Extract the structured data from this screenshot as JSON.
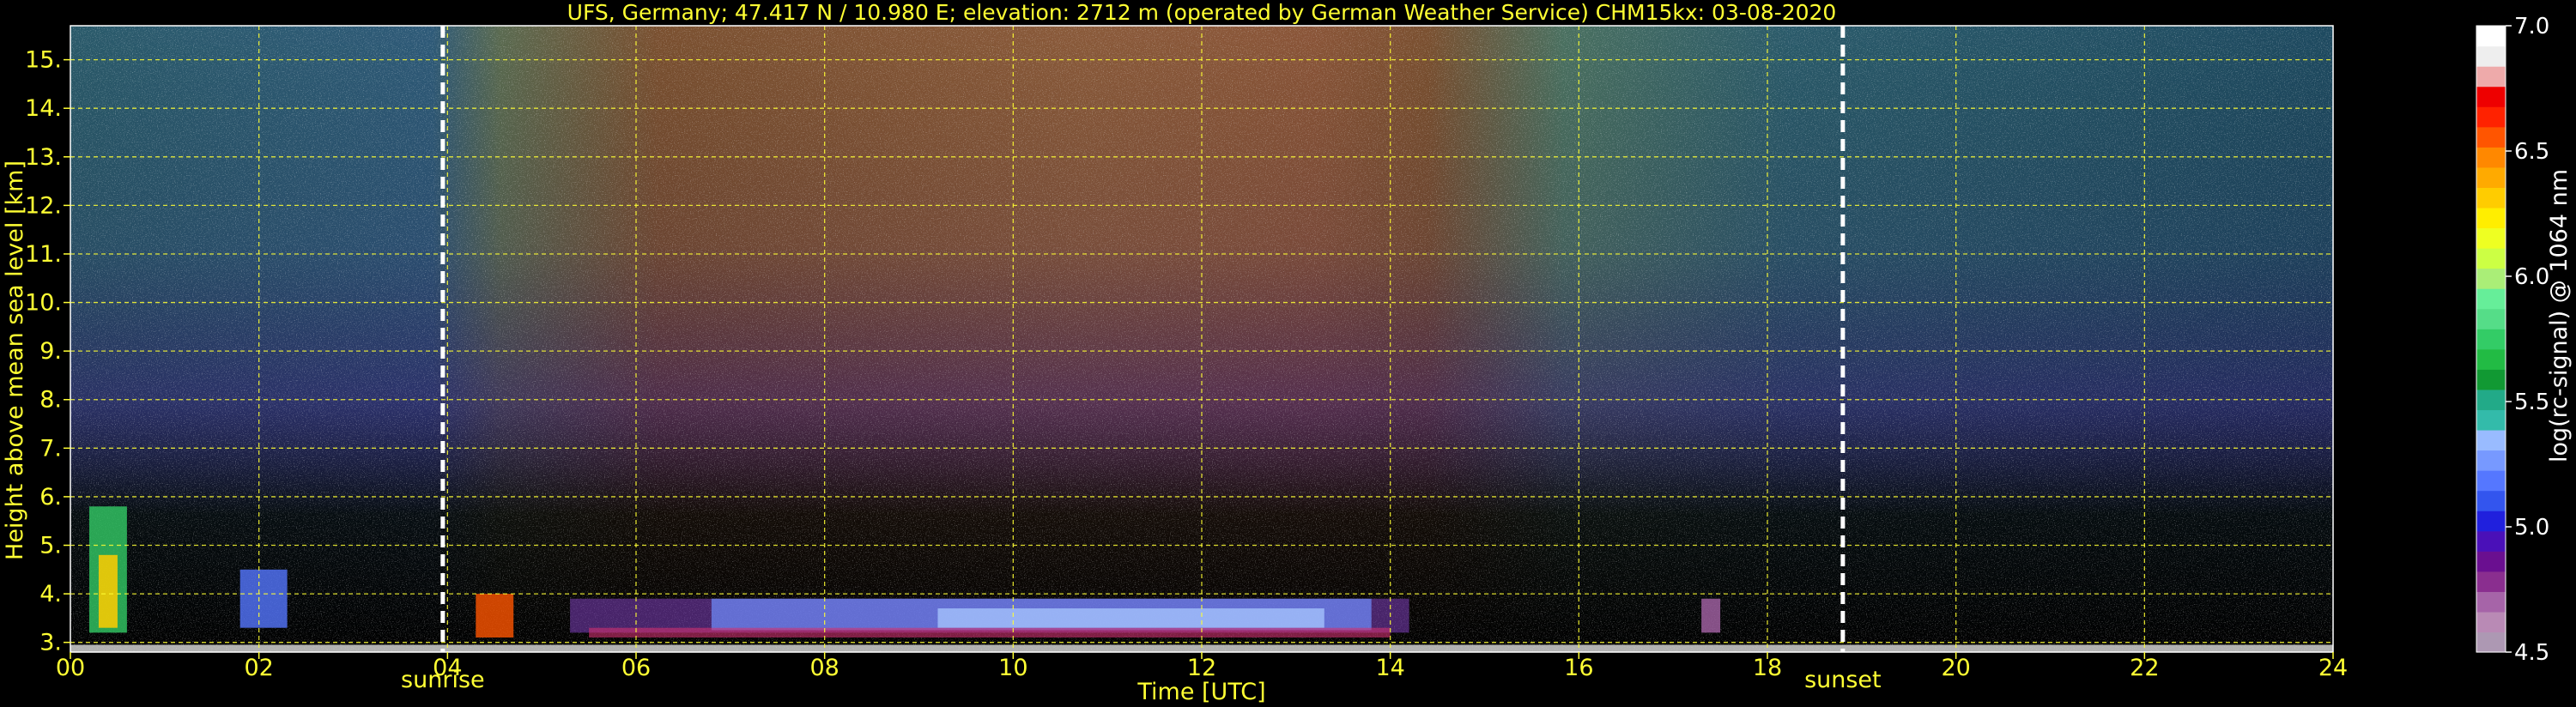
{
  "chart_data": {
    "type": "heatmap",
    "title": "UFS, Germany; 47.417 N / 10.980 E; elevation: 2712 m  (operated by German Weather Service)     CHM15kx: 03-08-2020",
    "xlabel": "Time [UTC]",
    "ylabel": "Height above mean sea level [km]",
    "colorbar_label": "log(rc-signal) @ 1064 nm",
    "xlim": [
      0,
      24
    ],
    "ylim": [
      2.8,
      15.7
    ],
    "x_ticks": [
      "00",
      "02",
      "04",
      "06",
      "08",
      "10",
      "12",
      "14",
      "16",
      "18",
      "20",
      "22",
      "24"
    ],
    "y_ticks": [
      "3.",
      "4.",
      "5.",
      "6.",
      "7.",
      "8.",
      "9.",
      "10.",
      "11.",
      "12.",
      "13.",
      "14.",
      "15."
    ],
    "y_tick_values": [
      3,
      4,
      5,
      6,
      7,
      8,
      9,
      10,
      11,
      12,
      13,
      14,
      15
    ],
    "colorbar_range": [
      4.5,
      7.0
    ],
    "colorbar_ticks": [
      "4.5",
      "5.0",
      "5.5",
      "6.0",
      "6.5",
      "7.0"
    ],
    "colorbar_tick_values": [
      4.5,
      5.0,
      5.5,
      6.0,
      6.5,
      7.0
    ],
    "colormap": [
      "#ad98b3",
      "#b98ab5",
      "#a664a8",
      "#8a2e8f",
      "#6a0f90",
      "#4a10b8",
      "#2020dd",
      "#3355ee",
      "#5577ff",
      "#7799ff",
      "#99bbff",
      "#33bbaa",
      "#22aa88",
      "#119933",
      "#22bb44",
      "#33cc66",
      "#55dd88",
      "#66ee99",
      "#aaee77",
      "#ccff44",
      "#eeff22",
      "#ffee00",
      "#ffcc00",
      "#ffaa00",
      "#ff8800",
      "#ff5500",
      "#ff2200",
      "#ee0000",
      "#eeaaaa",
      "#eeeeee",
      "#ffffff"
    ],
    "annotations": [
      {
        "label": "sunrise",
        "time": 3.95
      },
      {
        "label": "sunset",
        "time": 18.8
      }
    ],
    "grid": true,
    "grid_color": "#ffff33",
    "text_color": "#ffff33"
  }
}
